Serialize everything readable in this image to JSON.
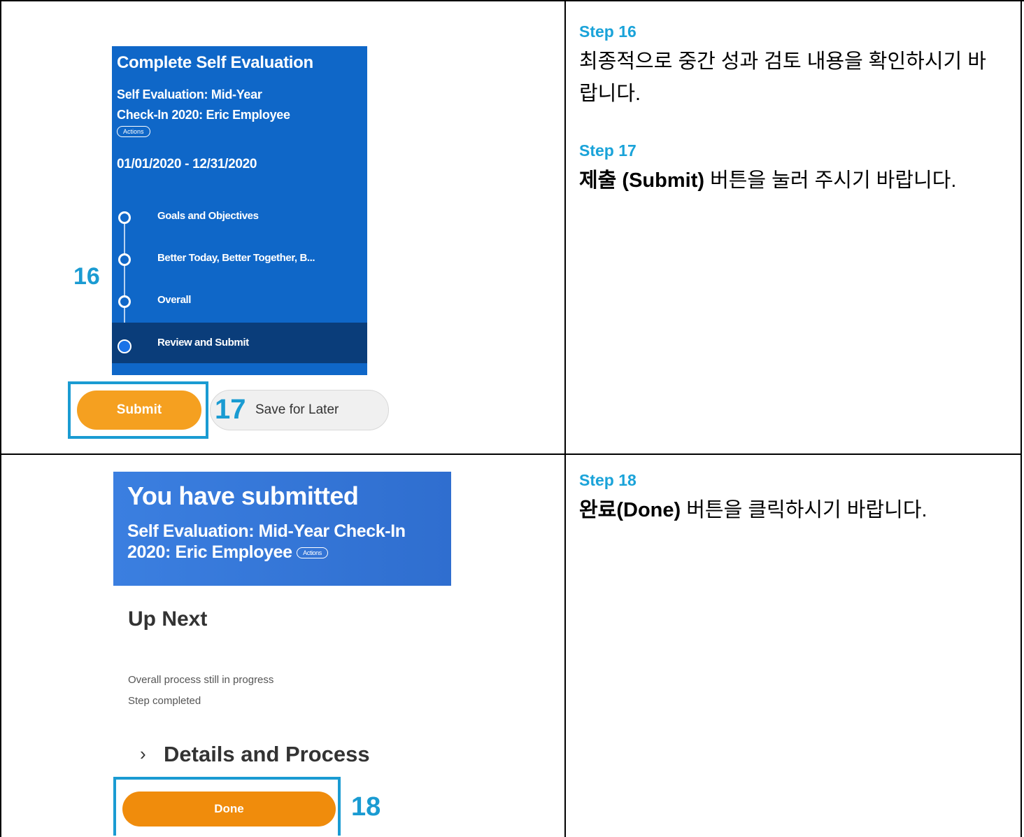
{
  "panel1": {
    "title": "Complete Self Evaluation",
    "subtitle_line1": "Self Evaluation: Mid-Year",
    "subtitle_line2": "Check-In 2020: Eric Employee",
    "actions_label": "Actions",
    "date_range": "01/01/2020 - 12/31/2020",
    "steps": [
      {
        "label": "Goals and Objectives"
      },
      {
        "label": "Better Today, Better Together, B..."
      },
      {
        "label": "Overall"
      },
      {
        "label": "Review and Submit"
      }
    ],
    "submit_label": "Submit",
    "save_label": "Save for Later",
    "annotation_16": "16",
    "annotation_17": "17"
  },
  "panel2": {
    "title": "You have submitted",
    "subtitle_line1": "Self Evaluation: Mid-Year Check-In",
    "subtitle_line2": "2020: Eric Employee",
    "actions_label": "Actions",
    "up_next": "Up Next",
    "status_1": "Overall process still in progress",
    "status_2": "Step completed",
    "chevron": "›",
    "details": "Details and Process",
    "done_label": "Done",
    "annotation_18": "18"
  },
  "instructions": {
    "step16_heading": "Step 16",
    "step16_text": "최종적으로 중간 성과 검토 내용을 확인하시기 바랍니다.",
    "step17_heading": "Step 17",
    "step17_bold": "제출 (Submit)",
    "step17_text": " 버튼을 눌러 주시기 바랍니다.",
    "step18_heading": "Step 18",
    "step18_bold": "완료(Done)",
    "step18_text": " 버튼을 클릭하시기 바랍니다."
  },
  "colors": {
    "workday_blue": "#0f67c8",
    "active_row": "#0a3d7a",
    "annotation_blue": "#1a9bd2",
    "submit_orange": "#f5a020",
    "done_orange": "#f08c0c",
    "step_heading": "#1aa3d9"
  }
}
